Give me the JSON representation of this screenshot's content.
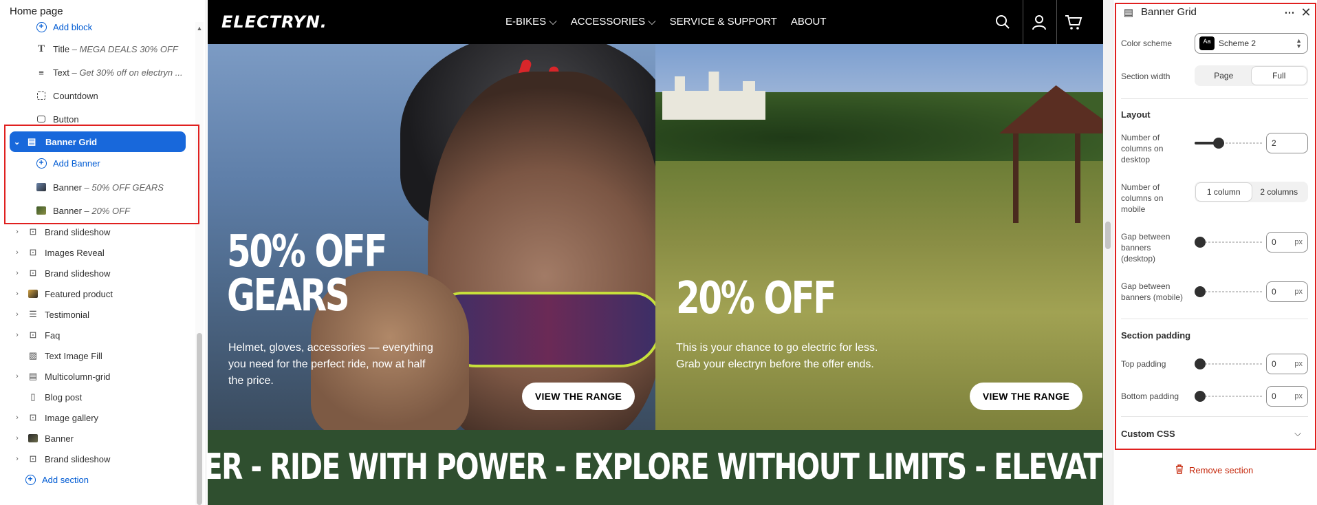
{
  "left_sidebar": {
    "title": "Home page",
    "blocks": [
      {
        "label": "Add block",
        "icon": "plus-circle-icon"
      },
      {
        "label": "Title",
        "detail": "MEGA DEALS 30% OFF",
        "icon": "text-title-icon"
      },
      {
        "label": "Text",
        "detail": "Get 30% off on electryn ...",
        "icon": "text-paragraph-icon"
      },
      {
        "label": "Countdown",
        "icon": "countdown-icon"
      },
      {
        "label": "Button",
        "icon": "button-icon"
      }
    ],
    "selected_section": {
      "label": "Banner Grid",
      "icon": "grid-icon"
    },
    "banner_children": [
      {
        "label": "Add Banner",
        "icon": "plus-circle-icon"
      },
      {
        "label": "Banner",
        "detail": "50% OFF GEARS",
        "icon": "image-thumbnail"
      },
      {
        "label": "Banner",
        "detail": "20% OFF",
        "icon": "image-thumbnail"
      }
    ],
    "sections": [
      {
        "label": "Brand slideshow",
        "icon": "slideshow-icon"
      },
      {
        "label": "Images Reveal",
        "icon": "image-icon"
      },
      {
        "label": "Brand slideshow",
        "icon": "slideshow-icon"
      },
      {
        "label": "Featured product",
        "icon": "product-thumbnail"
      },
      {
        "label": "Testimonial",
        "icon": "list-icon"
      },
      {
        "label": "Faq",
        "icon": "image-icon"
      },
      {
        "label": "Text Image Fill",
        "icon": "text-image-icon"
      },
      {
        "label": "Multicolumn-grid",
        "icon": "grid-icon"
      },
      {
        "label": "Blog post",
        "icon": "blog-icon"
      },
      {
        "label": "Image gallery",
        "icon": "image-icon"
      },
      {
        "label": "Banner",
        "icon": "banner-thumbnail"
      },
      {
        "label": "Brand slideshow",
        "icon": "slideshow-icon"
      }
    ],
    "add_section": "Add section"
  },
  "store": {
    "logo": "ELECTRYN.",
    "menu": [
      "E-BIKES",
      "ACCESSORIES",
      "SERVICE & SUPPORT",
      "ABOUT"
    ],
    "menu_dropdowns": [
      true,
      true,
      false,
      false
    ],
    "icons": [
      "search-icon",
      "account-icon",
      "cart-icon"
    ]
  },
  "banners": [
    {
      "title_line1": "50% OFF",
      "title_line2": "GEARS",
      "text": "Helmet, gloves, accessories — everything you need for the perfect ride, now at half the price.",
      "button": "VIEW THE RANGE"
    },
    {
      "title_line1": "20% OFF",
      "title_line2": "",
      "text": "This is your chance to go electric for less. Grab your electryn before the offer ends.",
      "button": "VIEW THE RANGE"
    }
  ],
  "marquee": "ER  -  RIDE WITH POWER  -  EXPLORE WITHOUT LIMITS  -  ELEVATE YOUR JOURNEY",
  "settings": {
    "title": "Banner Grid",
    "color_scheme_label": "Color scheme",
    "color_scheme_value": "Scheme 2",
    "swatch_text": "Aa",
    "section_width_label": "Section width",
    "section_width_options": [
      "Page",
      "Full"
    ],
    "section_width_selected": "Full",
    "layout_heading": "Layout",
    "columns_desktop_label": "Number of columns on desktop",
    "columns_desktop_value": "2",
    "columns_desktop_slider_fraction": 0.35,
    "columns_mobile_label": "Number of columns on mobile",
    "columns_mobile_options": [
      "1 column",
      "2 columns"
    ],
    "columns_mobile_selected": "1 column",
    "gap_desktop_label": "Gap between banners (desktop)",
    "gap_desktop_value": "0",
    "gap_mobile_label": "Gap between banners (mobile)",
    "gap_mobile_value": "0",
    "padding_heading": "Section padding",
    "top_padding_label": "Top padding",
    "top_padding_value": "0",
    "bottom_padding_label": "Bottom padding",
    "bottom_padding_value": "0",
    "unit": "px",
    "custom_css_label": "Custom CSS",
    "remove_section": "Remove section"
  },
  "colors": {
    "accent": "#1868db",
    "highlight_box": "#e0201f",
    "marquee_bg": "#2f4f2f",
    "remove": "#c5280c"
  }
}
